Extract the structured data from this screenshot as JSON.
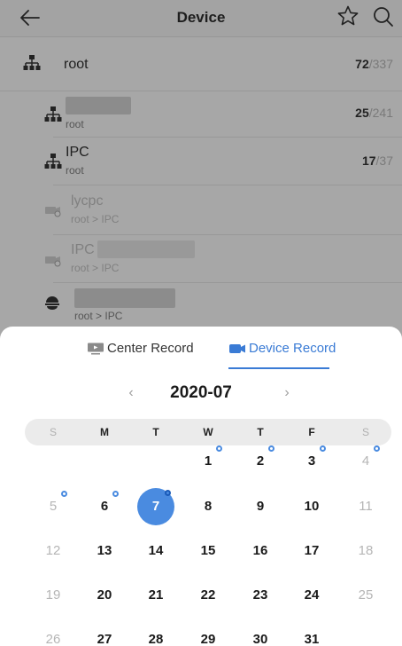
{
  "header": {
    "title": "Device"
  },
  "devices": [
    {
      "name": "root",
      "count": "72",
      "total": "/337"
    },
    {
      "path": "root",
      "count": "25",
      "total": "/241"
    },
    {
      "name": "IPC",
      "path": "root",
      "count": "17",
      "total": "/37"
    },
    {
      "name": "lycpc",
      "path": "root > IPC"
    },
    {
      "name": "IPC",
      "path": "root > IPC"
    },
    {
      "path": "root > IPC"
    }
  ],
  "tabs": {
    "center": "Center Record",
    "device": "Device Record"
  },
  "calendar": {
    "month_label": "2020-07",
    "prev": "‹",
    "next": "›",
    "weekdays": [
      "S",
      "M",
      "T",
      "W",
      "T",
      "F",
      "S"
    ],
    "weeks": [
      [
        "",
        "",
        "",
        "1",
        "2",
        "3",
        "4"
      ],
      [
        "5",
        "6",
        "7",
        "8",
        "9",
        "10",
        "11"
      ],
      [
        "12",
        "13",
        "14",
        "15",
        "16",
        "17",
        "18"
      ],
      [
        "19",
        "20",
        "21",
        "22",
        "23",
        "24",
        "25"
      ],
      [
        "26",
        "27",
        "28",
        "29",
        "30",
        "31",
        ""
      ]
    ],
    "selected_day": "7",
    "days_with_records": [
      "1",
      "2",
      "3",
      "4",
      "5",
      "6",
      "7"
    ]
  },
  "colors": {
    "accent": "#3a7bd5",
    "selected": "#4a8be0",
    "overlay": "#a7a7a7"
  }
}
